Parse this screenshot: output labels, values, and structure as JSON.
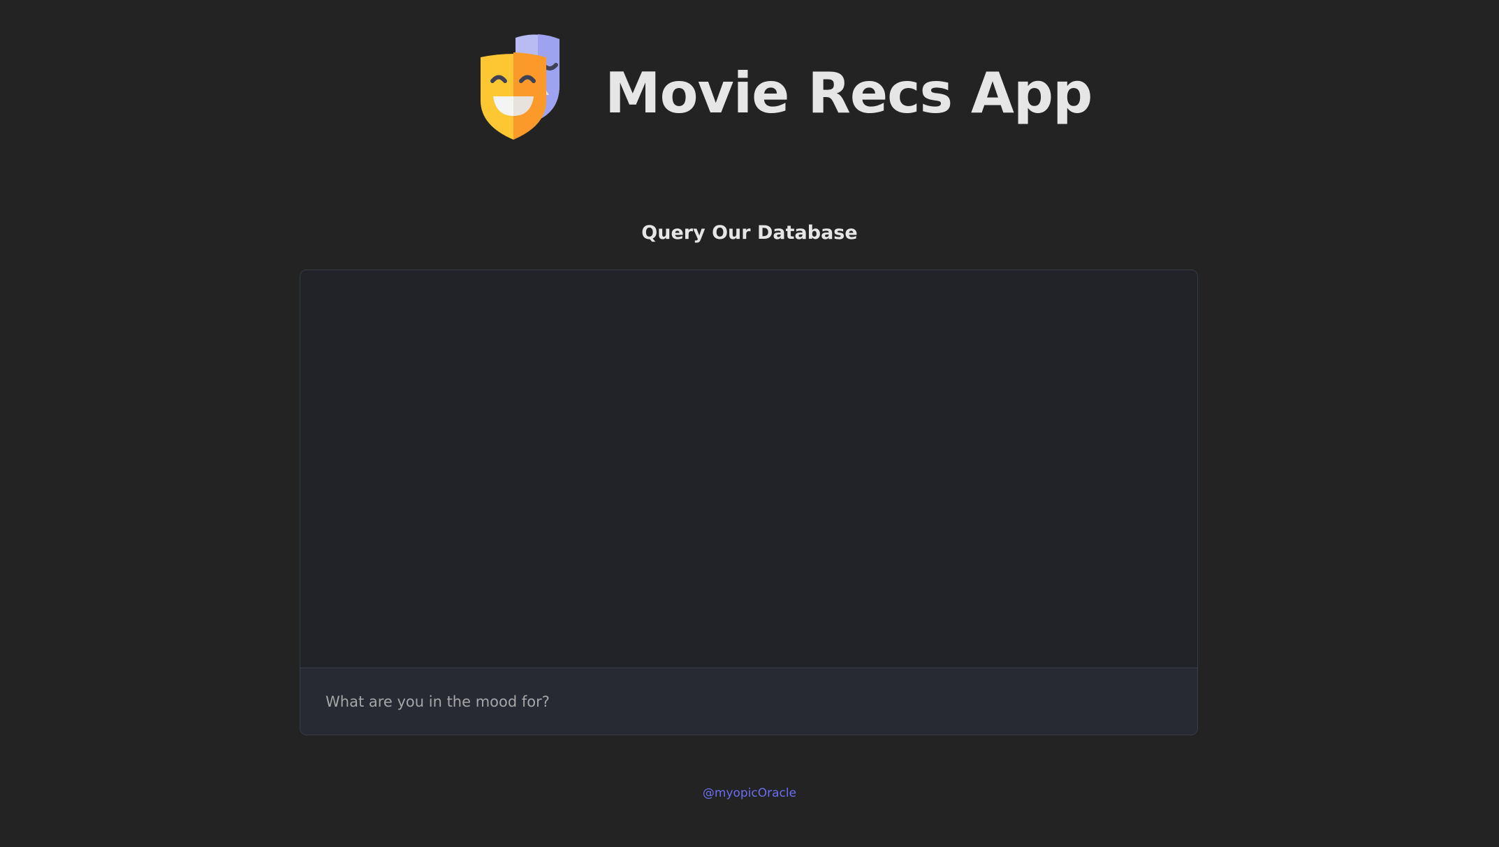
{
  "header": {
    "title": "Movie Recs App",
    "logo_icon": "theater-masks-icon"
  },
  "section": {
    "title": "Query Our Database"
  },
  "chat": {
    "messages": [],
    "input_placeholder": "What are you in the mood for?",
    "input_value": ""
  },
  "footer": {
    "link_text": "@myopicOracle"
  },
  "colors": {
    "background": "#232323",
    "chat_background": "#212328",
    "input_background": "#272a33",
    "border": "#3a3d44",
    "link": "#6b6ef0",
    "mask_yellow": "#fdc733",
    "mask_orange": "#fb9a2a",
    "mask_purple": "#9da3f0"
  }
}
